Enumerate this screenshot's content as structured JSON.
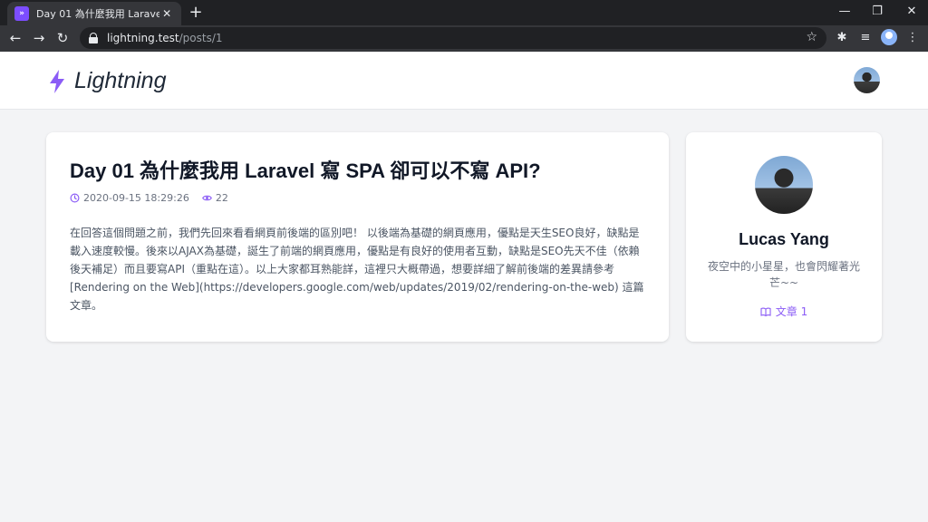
{
  "browser": {
    "tab_title": "Day 01 為什麼我用 Laravel 寫 SPA 卻可以不寫 API?",
    "tab_favicon": "»",
    "tab_close": "✕",
    "new_tab": "+",
    "minimize": "—",
    "restore": "❐",
    "close": "✕",
    "url_host": "lightning.test",
    "url_path": "/posts/1",
    "back": "←",
    "forward": "→",
    "reload": "↻",
    "star": "☆",
    "extensions": "✱",
    "media": "≡",
    "menu": "⋮"
  },
  "site": {
    "brand": "Lightning",
    "brand_color": "#8b5cf6"
  },
  "post": {
    "title": "Day 01 為什麼我用 Laravel 寫 SPA 卻可以不寫 API?",
    "datetime": "2020-09-15 18:29:26",
    "views": "22",
    "body": "在回答這個問題之前，我們先回來看看網頁前後端的區別吧！ 以後端為基礎的網頁應用，優點是天生SEO良好，缺點是載入速度較慢。後來以AJAX為基礎，誕生了前端的網頁應用，優點是有良好的使用者互動，缺點是SEO先天不佳（依賴後天補足）而且要寫API（重點在這）。以上大家都耳熟能詳，這裡只大概帶過，想要詳細了解前後端的差異請參考 [Rendering on the Web](https://developers.google.com/web/updates/2019/02/rendering-on-the-web) 這篇文章。"
  },
  "author": {
    "name": "Lucas Yang",
    "bio": "夜空中的小星星，也會閃耀著光芒~~",
    "posts_label": "文章 1"
  }
}
